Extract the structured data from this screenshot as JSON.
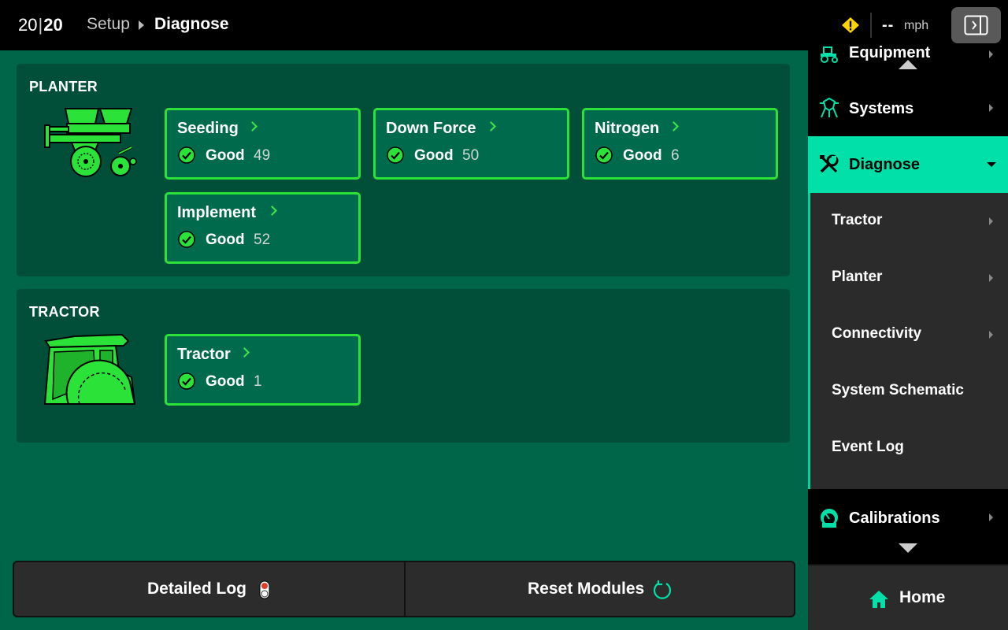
{
  "header": {
    "logo_left": "20",
    "logo_sep": "|",
    "logo_right": "20",
    "breadcrumb_parent": "Setup",
    "breadcrumb_current": "Diagnose",
    "speed_value": "--",
    "speed_unit": "mph"
  },
  "colors": {
    "main_bg": "#00664a",
    "section_bg": "#014f38",
    "card_border": "#2be238",
    "active_accent": "#00e0a8"
  },
  "sections": {
    "planter": {
      "title": "PLANTER",
      "cards": [
        {
          "title": "Seeding",
          "status": "Good",
          "count": "49"
        },
        {
          "title": "Down Force",
          "status": "Good",
          "count": "50"
        },
        {
          "title": "Nitrogen",
          "status": "Good",
          "count": "6"
        },
        {
          "title": "Implement",
          "status": "Good",
          "count": "52"
        }
      ]
    },
    "tractor": {
      "title": "TRACTOR",
      "cards": [
        {
          "title": "Tractor",
          "status": "Good",
          "count": "1"
        }
      ]
    }
  },
  "actions": {
    "detailed_log": "Detailed Log",
    "reset_modules": "Reset Modules"
  },
  "sidebar": {
    "equipment": "Equipment",
    "systems": "Systems",
    "diagnose": "Diagnose",
    "submenu": [
      "Tractor",
      "Planter",
      "Connectivity",
      "System Schematic",
      "Event Log"
    ],
    "calibrations": "Calibrations",
    "home": "Home"
  }
}
